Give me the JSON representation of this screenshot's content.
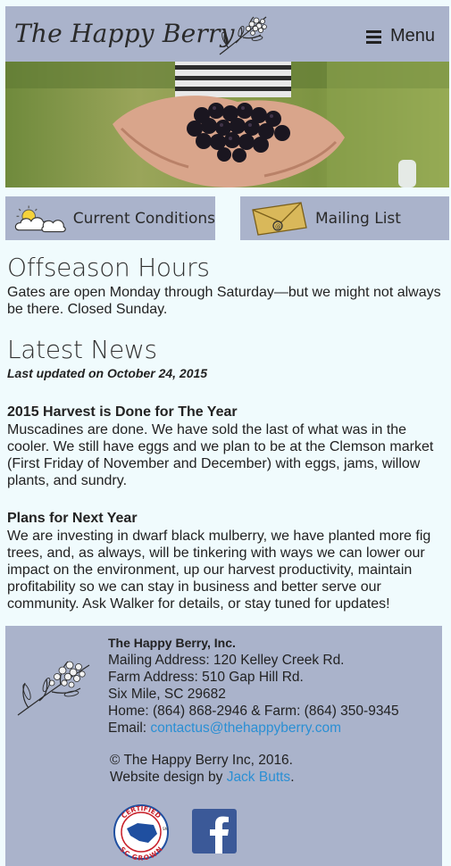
{
  "header": {
    "logo_text": "The Happy Berry",
    "menu_label": "Menu"
  },
  "quick_links": [
    {
      "label": "Current Conditions",
      "icon": "partly-cloudy-icon"
    },
    {
      "label": "Mailing List",
      "icon": "envelope-icon"
    }
  ],
  "offseason": {
    "heading": "Offseason Hours",
    "text": "Gates are open Monday through Saturday—but we might not always be there. Closed Sunday."
  },
  "news": {
    "heading": "Latest News",
    "updated": "Last updated on October 24, 2015",
    "items": [
      {
        "title": "2015 Harvest is Done for The Year",
        "body": "Muscadines are done. We have sold the last of what was in the cooler. We still have eggs and we plan to be at the Clemson market  (First Friday of November and December) with eggs, jams, willow plants, and sundry."
      },
      {
        "title": "Plans for Next Year",
        "body": "We are investing in dwarf black mulberry, we have planted more fig trees, and, as always, will be tinkering with ways we can lower our impact on the environment, up our harvest productivity, maintain profitability so we can stay in business and better serve our community. Ask Walker for details, or stay tuned for updates!"
      }
    ]
  },
  "footer": {
    "company": "The Happy Berry, Inc.",
    "mailing": "Mailing Address: 120 Kelley Creek Rd.",
    "farm": "Farm Address: 510 Gap Hill Rd.",
    "city": "Six Mile, SC 29682",
    "phones": "Home: (864) 868-2946 & Farm: (864) 350-9345",
    "email_label": "Email: ",
    "email": "contactus@thehappyberry.com",
    "copyright": "© The Happy Berry Inc, 2016.",
    "design_prefix": "Website design by ",
    "designer": "Jack Butts",
    "design_suffix": ".",
    "badge_top": "CERTIFIED",
    "badge_bottom": "SC GROWN",
    "badge_sm": "SM"
  },
  "colors": {
    "page_bg": "#f0fbfd",
    "panel": "#aab3cb",
    "link": "#2a8fd4",
    "facebook": "#3b5998"
  }
}
